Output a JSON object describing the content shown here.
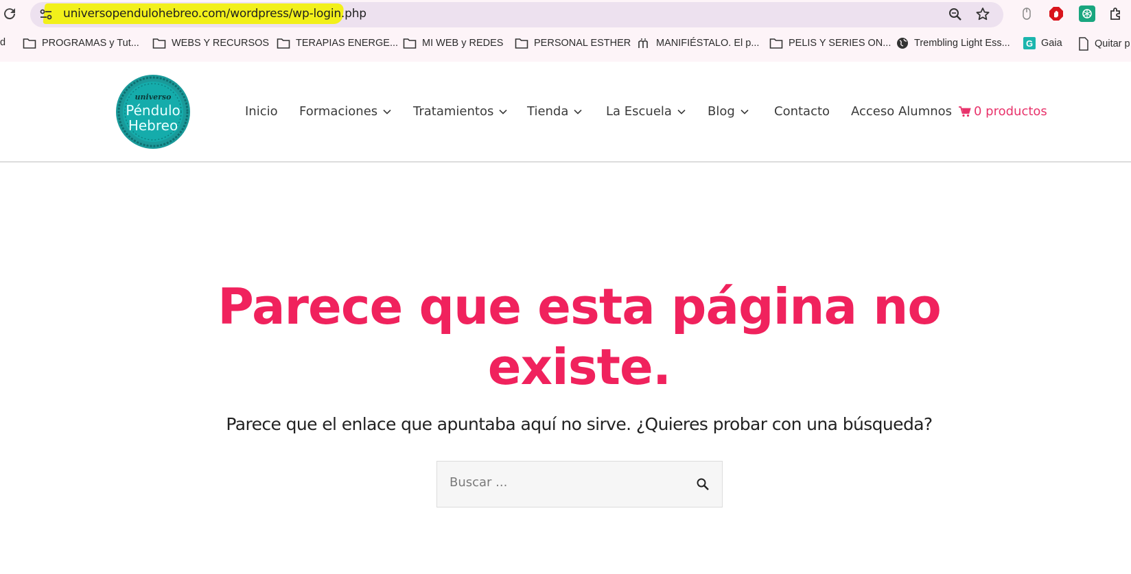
{
  "browser": {
    "url": "universopendulohebreo.com/wordpress/wp-login.php",
    "bookmarks": [
      {
        "label": "d",
        "icon": "folder-icon"
      },
      {
        "label": "PROGRAMAS y Tut...",
        "icon": "folder-icon"
      },
      {
        "label": "WEBS Y RECURSOS",
        "icon": "folder-icon"
      },
      {
        "label": "TERAPIAS ENERGE...",
        "icon": "folder-icon"
      },
      {
        "label": "MI WEB y REDES",
        "icon": "folder-icon"
      },
      {
        "label": "PERSONAL ESTHER",
        "icon": "folder-icon"
      },
      {
        "label": "MANIFIÉSTALO. El p...",
        "icon": "manifiestalo-icon"
      },
      {
        "label": "PELIS Y SERIES ON...",
        "icon": "folder-icon"
      },
      {
        "label": "Trembling Light Ess...",
        "icon": "globe-icon"
      },
      {
        "label": "Gaia",
        "icon": "gaia-icon"
      },
      {
        "label": "Quitar p",
        "icon": "page-icon"
      }
    ],
    "gaia_letter": "G"
  },
  "site": {
    "logo": {
      "top": "universo",
      "line1": "Péndulo",
      "line2": "Hebreo"
    },
    "nav": [
      {
        "label": "Inicio"
      },
      {
        "label": "Formaciones"
      },
      {
        "label": "Tratamientos"
      },
      {
        "label": "Tienda"
      },
      {
        "label": "La Escuela"
      },
      {
        "label": "Blog"
      },
      {
        "label": "Contacto"
      },
      {
        "label": "Acceso Alumnos"
      }
    ],
    "cart_label": "0 productos"
  },
  "main": {
    "headline_line1": "Parece que esta página no",
    "headline_line2": "existe.",
    "subline": "Parece que el enlace que apuntaba aquí no sirve. ¿Quieres probar con una búsqueda?",
    "search_placeholder": "Buscar ..."
  },
  "colors": {
    "accent": "#f0225d",
    "logo_teal": "#14a8a8",
    "highlight": "#f2f01a"
  }
}
